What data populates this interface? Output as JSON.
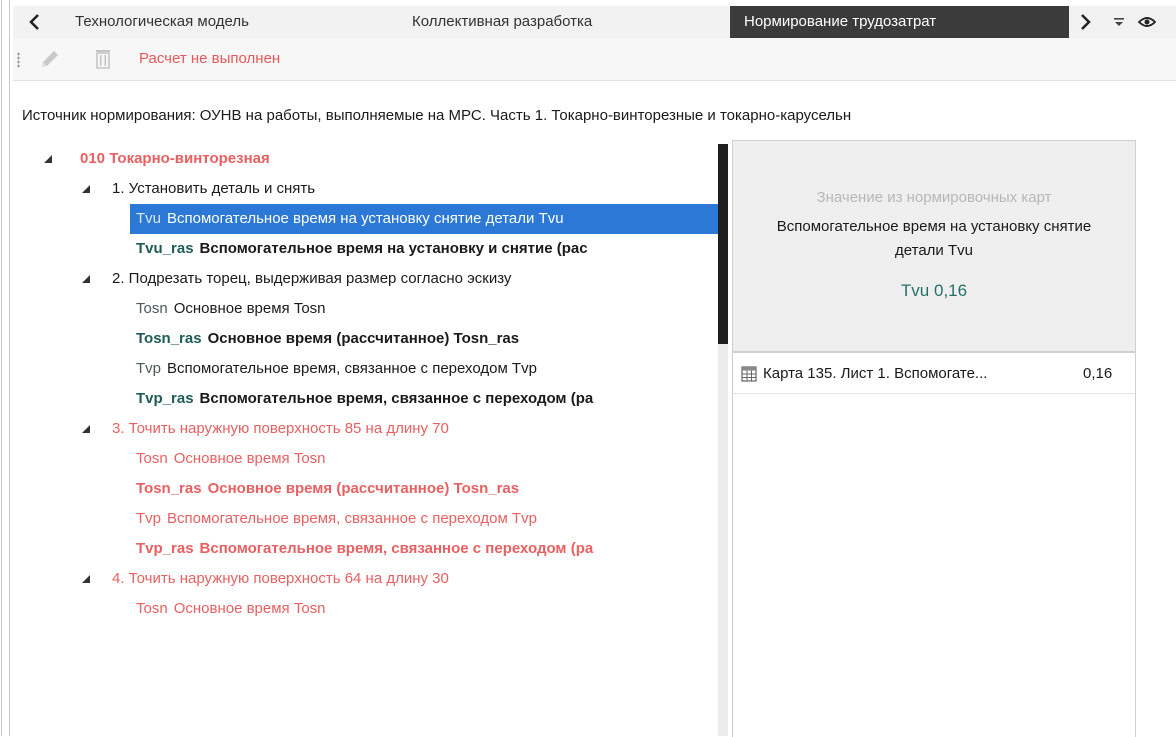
{
  "tabs": {
    "items": [
      "Технологическая модель",
      "Коллективная разработка",
      "Нормирование трудозатрат"
    ],
    "active_index": 2
  },
  "toolbar": {
    "edit_icon": "pencil-icon",
    "delete_icon": "trash-icon",
    "status": "Расчет не выполнен"
  },
  "source": {
    "text": "Источник нормирования: ОУНВ на работы, выполняемые на МРС. Часть 1. Токарно-винторезные и токарно-карусельн"
  },
  "tree": {
    "op": "010 Токарно-винторезная",
    "s1": {
      "label": "1. Установить деталь и снять",
      "tvu_code": "Tvu",
      "tvu_label": "Вспомогательное время на установку снятие детали Tvu",
      "tvuras_code": "Tvu_ras",
      "tvuras_label": "Вспомогательное время на установку и снятие (рас"
    },
    "s2": {
      "label": "2. Подрезать торец, выдерживая размер согласно эскизу",
      "tosn_code": "Tosn",
      "tosn_label": "Основное время Tosn",
      "tosnras_code": "Tosn_ras",
      "tosnras_label": "Основное время (рассчитанное) Tosn_ras",
      "tvp_code": "Tvp",
      "tvp_label": "Вспомогательное время, связанное с переходом Tvp",
      "tvpras_code": "Tvp_ras",
      "tvpras_label": "Вспомогательное время, связанное с переходом (ра"
    },
    "s3": {
      "label": "3. Точить наружную поверхность 85 на длину 70",
      "tosn_code": "Tosn",
      "tosn_label": "Основное время Tosn",
      "tosnras_code": "Tosn_ras",
      "tosnras_label": "Основное время (рассчитанное) Tosn_ras",
      "tvp_code": "Tvp",
      "tvp_label": "Вспомогательное время, связанное с переходом Tvp",
      "tvpras_code": "Tvp_ras",
      "tvpras_label": "Вспомогательное время, связанное с переходом (ра"
    },
    "s4": {
      "label": "4. Точить наружную поверхность 64 на длину 30",
      "tosn_code": "Tosn",
      "tosn_label": "Основное время Tosn"
    }
  },
  "panel": {
    "caption": "Значение из нормировочных карт",
    "name": "Вспомогательное время на установку снятие детали Tvu",
    "value": "Tvu 0,16",
    "cards": [
      {
        "name": "Карта 135. Лист 1. Вспомогате...",
        "value": "0,16"
      }
    ]
  },
  "colors": {
    "accent_red": "#e86062",
    "selection": "#2b78d6",
    "code_green": "#1f5c56",
    "active_tab": "#3b3b3b"
  }
}
